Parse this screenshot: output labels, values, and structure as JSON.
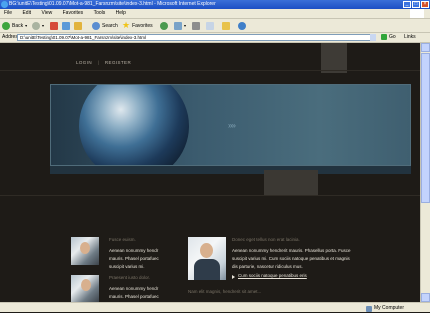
{
  "window": {
    "title": "BG:\\unitE\\Testing\\01.09.07\\Mot-a-981_Farsnzm\\site\\index-3.html - Microsoft Internet Explorer"
  },
  "menu": {
    "items": [
      "File",
      "Edit",
      "View",
      "Favorites",
      "Tools",
      "Help"
    ]
  },
  "toolbar": {
    "back_label": "Back",
    "search_label": "Search",
    "favorites_label": "Favorites"
  },
  "address": {
    "label": "Address",
    "value": "D:\\unitE\\Testing\\01.09.07\\Mot-a-981_Farsnzm\\site\\index-3.html",
    "go_label": "Go",
    "links_label": "Links"
  },
  "page": {
    "nav": {
      "login": "LOGIN",
      "sep": "|",
      "register": "REGISTER"
    },
    "left_items": [
      {
        "heading": "Fusce euism.",
        "lines": [
          "Aenean nonummy hendr",
          "mauris. Phasel portafuec",
          "suscipit varius mi."
        ]
      },
      {
        "heading": "Praesent iusto dolor.",
        "lines": [
          "Aenean nonummy hendr",
          "mauris. Phasel portafuec"
        ]
      }
    ],
    "feature": {
      "heading": "Donec eget tellus non erat lacinia.",
      "lines": [
        "Aenean nonummy hendrerit mauris. Phasellus porta. Fusce",
        "suscipit varius mi. Cum sociis natoque penatibus et magnis",
        "dis parturie, nascetur ridiculus mus."
      ],
      "link": "Cum sociis natoque penatibus eris"
    },
    "bottom_heading": "Nam elit magnis, hendrerit sit amet..."
  },
  "status": {
    "left": "",
    "zone": "My Computer"
  },
  "colors": {
    "page_bg": "#1e1b17",
    "banner": "#3b5b6e",
    "text": "#e9e4d9",
    "heading": "#7a7366"
  }
}
